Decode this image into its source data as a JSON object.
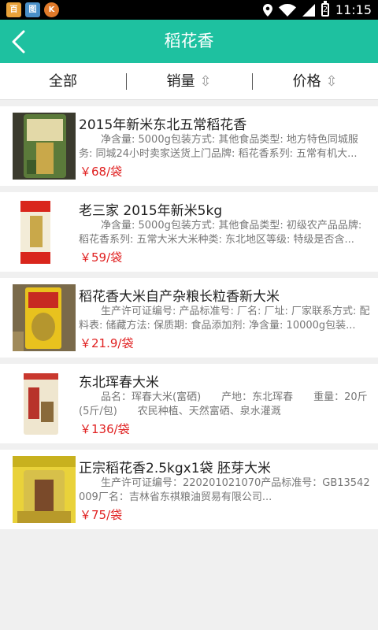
{
  "status_bar": {
    "time": "11:15",
    "battery_level": "2",
    "apps": [
      "百",
      "图",
      "K"
    ],
    "icons": [
      "location-icon",
      "wifi-icon",
      "signal-icon",
      "battery-icon"
    ]
  },
  "header": {
    "title": "稻花香",
    "back_icon": "chevron-left-icon"
  },
  "filters": {
    "all": "全部",
    "sales": "销量",
    "price": "价格",
    "sort_icon": "⇳"
  },
  "colors": {
    "accent": "#1ec1a0",
    "price": "#e02020"
  },
  "products": [
    {
      "title": "2015年新米东北五常稻花香",
      "desc": "净含量: 5000g包装方式: 其他食品类型: 地方特色同城服务: 同城24小时卖家送货上门品牌: 稻花香系列: 五常有机大...",
      "price": "￥68/袋"
    },
    {
      "title": "老三家 2015年新米5kg",
      "desc": "净含量: 5000g包装方式: 其他食品类型: 初级农产品品牌: 稻花香系列: 五常大米大米种类: 东北地区等级: 特级是否含...",
      "price": "￥59/袋"
    },
    {
      "title": "稻花香大米自产杂粮长粒香新大米",
      "desc": "生产许可证编号: 产品标准号: 厂名: 厂址: 厂家联系方式: 配料表: 储藏方法: 保质期: 食品添加剂: 净含量: 10000g包装...",
      "price": "￥21.9/袋"
    },
    {
      "title": "东北珲春大米",
      "desc": "品名：珲春大米(富硒)　　产地：东北珲春　　重量：20斤(5斤/包)　　农民种植、天然富硒、泉水灌溉",
      "price": "￥136/袋"
    },
    {
      "title": "正宗稻花香2.5kgx1袋 胚芽大米",
      "desc": "生产许可证编号：220201021070产品标准号：GB13542009厂名：吉林省东祺粮油贸易有限公司...",
      "price": "￥75/袋"
    }
  ]
}
